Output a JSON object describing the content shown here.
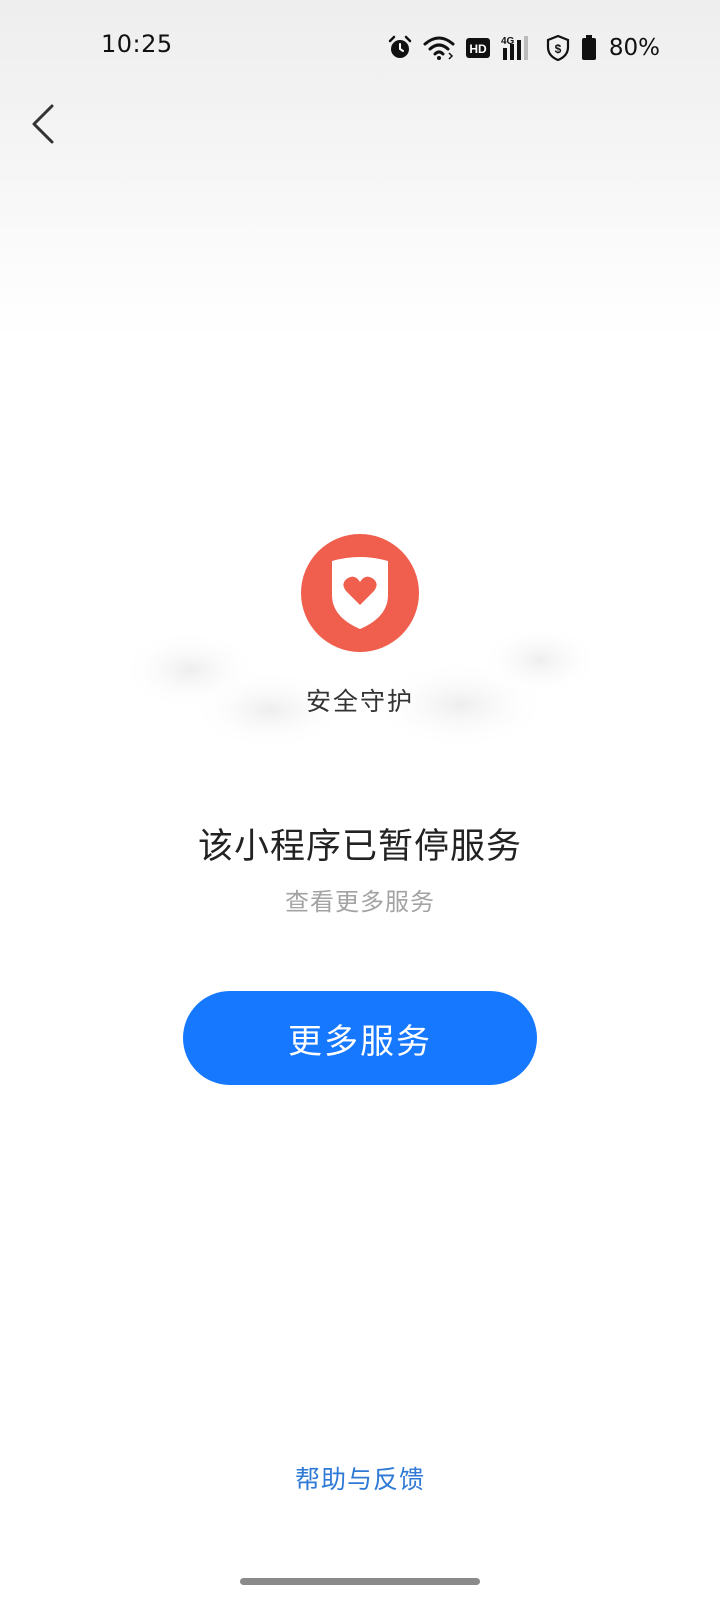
{
  "status_bar": {
    "time": "10:25",
    "network": "4G",
    "battery": "80%",
    "icons": [
      "alarm-icon",
      "wifi-icon",
      "hd-icon",
      "signal-icon",
      "shield-dollar-icon",
      "battery-icon"
    ]
  },
  "nav": {
    "back_icon": "chevron-left-icon"
  },
  "badge": {
    "icon": "shield-heart-icon",
    "label": "安全守护",
    "color": "#f05e4d"
  },
  "message": {
    "title": "该小程序已暂停服务",
    "subtitle": "查看更多服务"
  },
  "primary_button": {
    "label": "更多服务",
    "color": "#1677ff"
  },
  "footer": {
    "help_link": "帮助与反馈",
    "link_color": "#2e7ad6"
  }
}
